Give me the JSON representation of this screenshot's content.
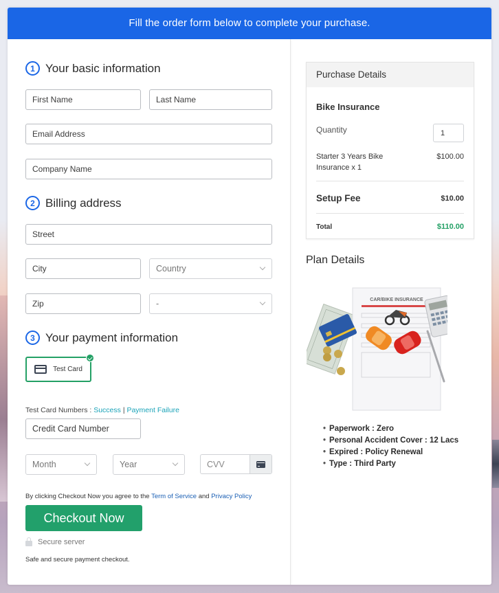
{
  "banner": {
    "text": "Fill the order form below to complete your purchase."
  },
  "sections": {
    "basic": {
      "step": "1",
      "title": "Your basic information"
    },
    "billing": {
      "step": "2",
      "title": "Billing address"
    },
    "payment": {
      "step": "3",
      "title": "Your payment information"
    }
  },
  "fields": {
    "first_name": {
      "placeholder": "First Name"
    },
    "last_name": {
      "placeholder": "Last Name"
    },
    "email": {
      "placeholder": "Email Address"
    },
    "company": {
      "placeholder": "Company Name"
    },
    "street": {
      "placeholder": "Street"
    },
    "city": {
      "placeholder": "City"
    },
    "country": {
      "selected": "Country"
    },
    "zip": {
      "placeholder": "Zip"
    },
    "state": {
      "selected": "-"
    },
    "credit_card": {
      "placeholder": "Credit Card Number"
    },
    "month": {
      "selected": "Month"
    },
    "year": {
      "selected": "Year"
    },
    "cvv": {
      "placeholder": "CVV"
    }
  },
  "payment": {
    "method_label": "Test Card",
    "test_numbers_label": "Test Card Numbers :",
    "success_link": "Success",
    "separator": "|",
    "failure_link": "Payment Failure"
  },
  "agreement": {
    "prefix": "By clicking Checkout Now you agree to the",
    "terms_link": "Term of Service",
    "and": "and",
    "privacy_link": "Privacy Policy"
  },
  "checkout": {
    "button_label": "Checkout Now",
    "secure_label": "Secure server",
    "safe_text": "Safe and secure payment checkout."
  },
  "purchase": {
    "header": "Purchase Details",
    "product": "Bike Insurance",
    "quantity_label": "Quantity",
    "quantity_value": "1",
    "line_item_line1": "Starter 3 Years Bike",
    "line_item_line2": "Insurance x 1",
    "line_item_price": "$100.00",
    "setup_fee_label": "Setup Fee",
    "setup_fee_value": "$10.00",
    "total_label": "Total",
    "total_value": "$110.00"
  },
  "plan": {
    "title": "Plan Details",
    "image_caption": "CAR/BIKE INSURANCE",
    "items": [
      "Paperwork : Zero",
      "Personal Accident Cover : 12 Lacs",
      "Expired : Policy Renewal",
      "Type : Third Party"
    ]
  },
  "colors": {
    "brand_blue": "#1a66e6",
    "success_green": "#23a065",
    "link_teal": "#1aa3b8"
  }
}
